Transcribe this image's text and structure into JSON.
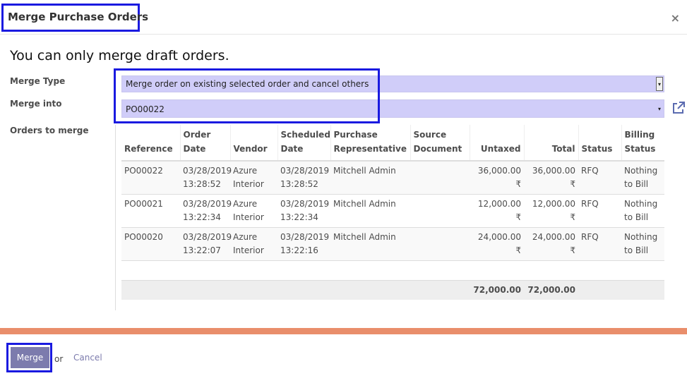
{
  "dialog": {
    "title": "Merge Purchase Orders",
    "close_label": "×"
  },
  "notice": "You can only merge draft orders.",
  "form": {
    "merge_type": {
      "label": "Merge Type",
      "value": "Merge order on existing selected order and cancel others"
    },
    "merge_into": {
      "label": "Merge into",
      "value": "PO00022"
    },
    "orders_label": "Orders to merge"
  },
  "table": {
    "headers": {
      "reference": "Reference",
      "order_date": [
        "Order",
        "Date"
      ],
      "vendor": "Vendor",
      "scheduled_date": [
        "Scheduled",
        "Date"
      ],
      "purchase_rep": [
        "Purchase",
        "Representative"
      ],
      "source_document": [
        "Source",
        "Document"
      ],
      "untaxed": "Untaxed",
      "total": "Total",
      "status": "Status",
      "billing_status": [
        "Billing",
        "Status"
      ]
    },
    "rows": [
      {
        "reference": "PO00022",
        "order_date": [
          "03/28/2019",
          "13:28:52"
        ],
        "vendor": [
          "Azure",
          "Interior"
        ],
        "scheduled_date": [
          "03/28/2019",
          "13:28:52"
        ],
        "purchase_rep": "Mitchell Admin",
        "source_document": "",
        "untaxed": "36,000.00 ₹",
        "total": "36,000.00 ₹",
        "status": "RFQ",
        "billing_status": [
          "Nothing",
          "to Bill"
        ]
      },
      {
        "reference": "PO00021",
        "order_date": [
          "03/28/2019",
          "13:22:34"
        ],
        "vendor": [
          "Azure",
          "Interior"
        ],
        "scheduled_date": [
          "03/28/2019",
          "13:22:34"
        ],
        "purchase_rep": "Mitchell Admin",
        "source_document": "",
        "untaxed": "12,000.00 ₹",
        "total": "12,000.00 ₹",
        "status": "RFQ",
        "billing_status": [
          "Nothing",
          "to Bill"
        ]
      },
      {
        "reference": "PO00020",
        "order_date": [
          "03/28/2019",
          "13:22:07"
        ],
        "vendor": [
          "Azure",
          "Interior"
        ],
        "scheduled_date": [
          "03/28/2019",
          "13:22:16"
        ],
        "purchase_rep": "Mitchell Admin",
        "source_document": "",
        "untaxed": "24,000.00 ₹",
        "total": "24,000.00 ₹",
        "status": "RFQ",
        "billing_status": [
          "Nothing",
          "to Bill"
        ]
      }
    ],
    "footer": {
      "untaxed_total": "72,000.00",
      "total": "72,000.00"
    }
  },
  "footer": {
    "merge_label": "Merge",
    "or_text": "or",
    "cancel_label": "Cancel"
  },
  "colors": {
    "highlight_border": "#1a1ae0",
    "select_bg": "#d0cdf9",
    "primary_button": "#7c7bad",
    "accent_bar": "#e98e6b"
  }
}
